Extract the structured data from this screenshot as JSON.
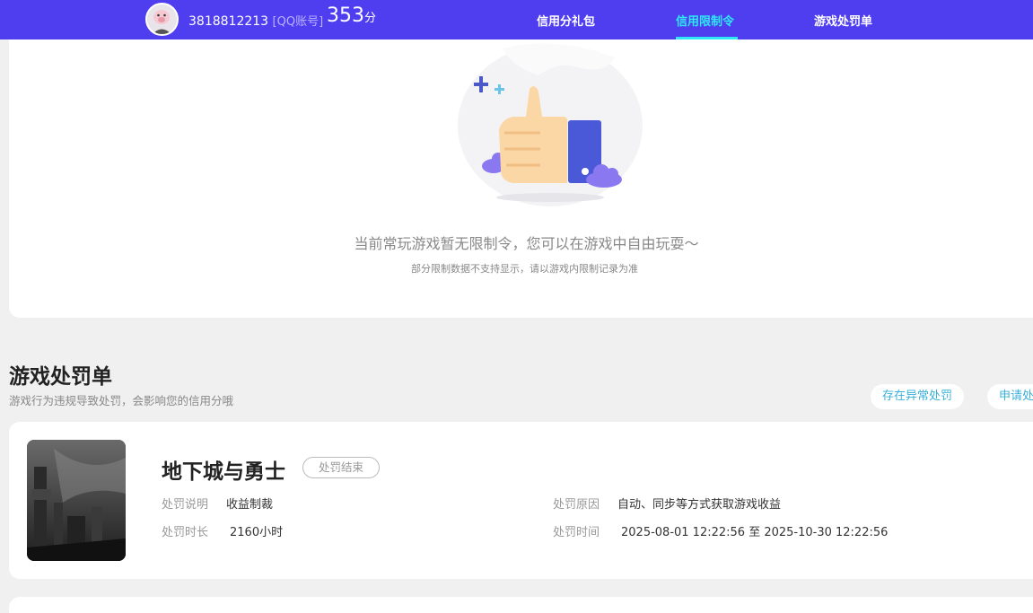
{
  "header": {
    "account_id": "3818812213",
    "account_type": "[QQ账号]",
    "score": "353",
    "score_unit": "分",
    "tabs": [
      {
        "label": "信用分礼包",
        "active": false
      },
      {
        "label": "信用限制令",
        "active": true
      },
      {
        "label": "游戏处罚单",
        "active": false
      }
    ]
  },
  "restriction": {
    "empty_title": "当前常玩游戏暂无限制令，您可以在游戏中自由玩耍～",
    "empty_subtitle": "部分限制数据不支持显示，请以游戏内限制记录为准"
  },
  "punishment_section": {
    "title": "游戏处罚单",
    "subtitle": "游戏行为违规导致处罚，会影响您的信用分哦",
    "buttons": [
      "存在异常处罚",
      "申请处"
    ]
  },
  "punishments": [
    {
      "game": "地下城与勇士",
      "status": "处罚结束",
      "desc_label": "处罚说明",
      "desc_value": "收益制裁",
      "reason_label": "处罚原因",
      "reason_value": "自动、同步等方式获取游戏收益",
      "duration_label": "处罚时长",
      "duration_value": "2160小时",
      "time_label": "处罚时间",
      "time_value": "2025-08-01 12:22:56 至 2025-10-30 12:22:56"
    }
  ],
  "colors": {
    "header_bg": "#4f3ef0",
    "active_tab": "#2ee8f5",
    "link": "#3ab0d8"
  }
}
